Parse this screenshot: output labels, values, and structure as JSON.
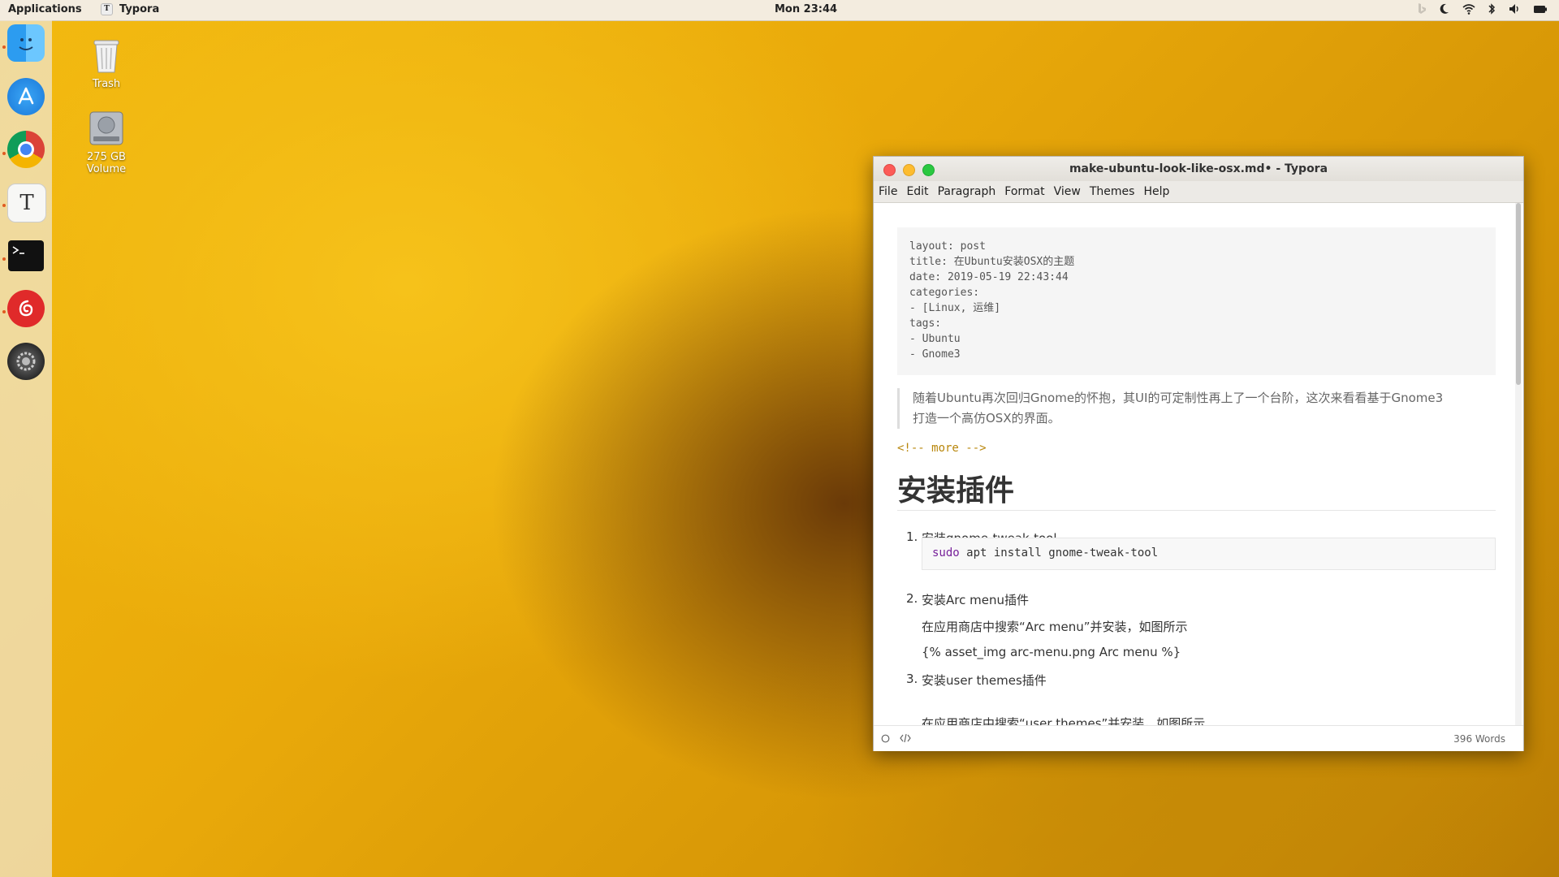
{
  "topbar": {
    "applications": "Applications",
    "active_app": "Typora",
    "active_app_glyph": "T",
    "clock": "Mon 23:44",
    "tray_icons": [
      "bing-icon",
      "night-light-icon",
      "wifi-icon",
      "bluetooth-icon",
      "volume-icon",
      "battery-icon"
    ]
  },
  "dock": {
    "items": [
      "finder-icon",
      "app-store-icon",
      "chrome-icon",
      "typora-icon",
      "terminal-icon",
      "netease-music-icon",
      "settings-icon"
    ]
  },
  "desktop": {
    "trash_label": "Trash",
    "volume_label_1": "275 GB",
    "volume_label_2": "Volume"
  },
  "window": {
    "title": "make-ubuntu-look-like-osx.md• - Typora",
    "menu": [
      "File",
      "Edit",
      "Paragraph",
      "Format",
      "View",
      "Themes",
      "Help"
    ],
    "yaml_lines": [
      "layout: post",
      "title: 在Ubuntu安装OSX的主题",
      "date: 2019-05-19 22:43:44",
      "categories:",
      "- [Linux, 运维]",
      "tags:",
      "- Ubuntu",
      "- Gnome3"
    ],
    "quote_line1": "随着Ubuntu再次回归Gnome的怀抱，其UI的可定制性再上了一个台阶，这次来看看基于Gnome3",
    "quote_line2": "打造一个高仿OSX的界面。",
    "comment": "<!-- more -->",
    "heading": "安装插件",
    "list": [
      {
        "num": "1.",
        "text": "安装gnome-tweak-tool"
      },
      {
        "num": "2.",
        "text": "安装Arc menu插件"
      },
      {
        "num": "3.",
        "text": "安装user themes插件"
      }
    ],
    "code_kw": "sudo",
    "code_rest": " apt install gnome-tweak-tool",
    "para_arc": "在应用商店中搜索“Arc menu”并安装，如图所示",
    "para_asset": "{% asset_img arc-menu.png Arc menu %}",
    "para_user": "在应用商店中搜索“user themes”并安装，如图所示",
    "word_count": "396 Words"
  }
}
